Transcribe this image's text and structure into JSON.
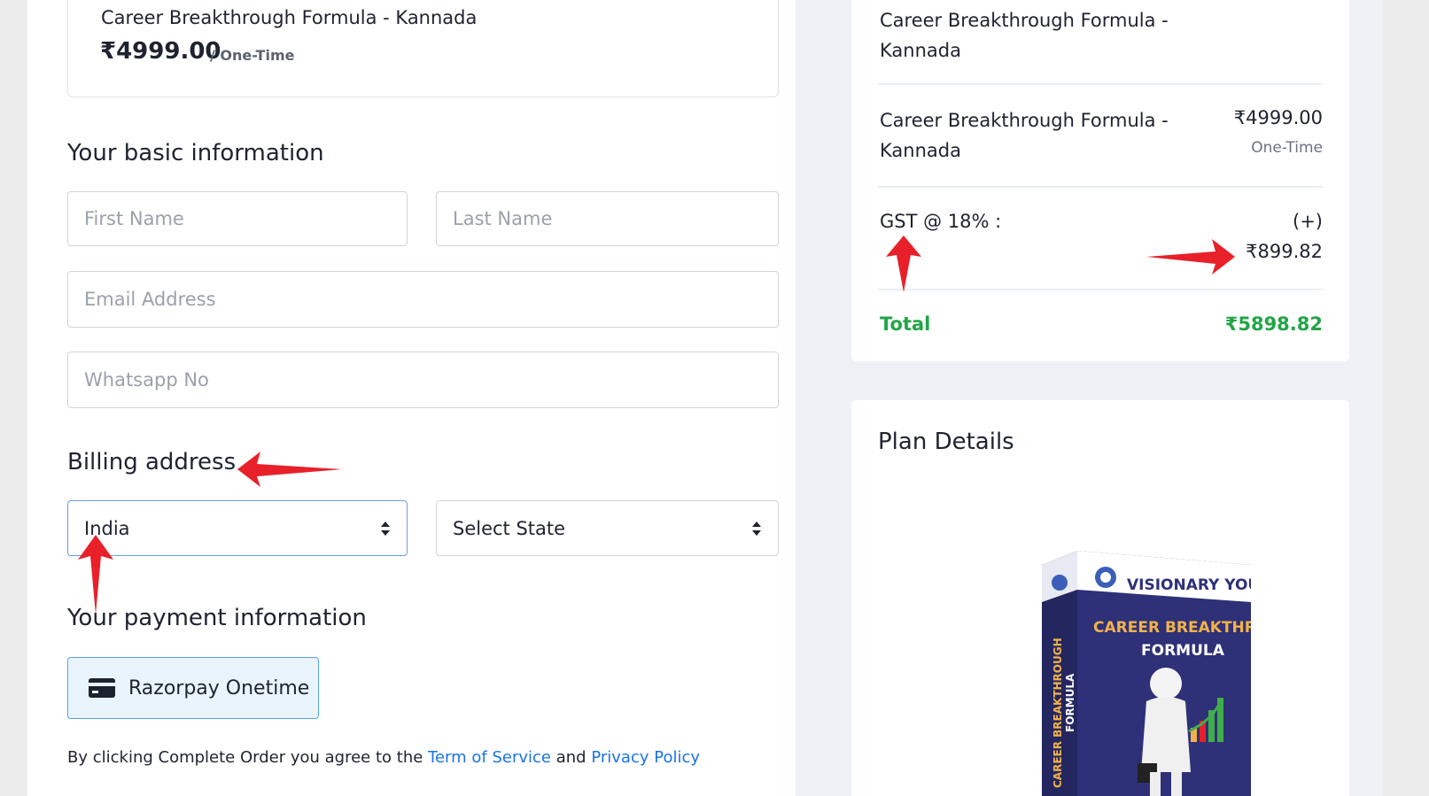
{
  "product": {
    "name": "Career Breakthrough Formula - Kannada",
    "price": "₹4999.00",
    "period": "/ One-Time"
  },
  "basic_info": {
    "title": "Your basic information",
    "first_name_placeholder": "First Name",
    "last_name_placeholder": "Last Name",
    "email_placeholder": "Email Address",
    "whatsapp_placeholder": "Whatsapp No"
  },
  "billing": {
    "title": "Billing address",
    "country_value": "India",
    "state_value": "Select State"
  },
  "payment": {
    "title": "Your payment information",
    "method_label": "Razorpay Onetime",
    "agree_prefix": "By clicking Complete Order you agree to the",
    "terms_link": "Term of Service",
    "agree_and": "and",
    "privacy_link": "Privacy Policy"
  },
  "summary": {
    "title": "Career Breakthrough Formula - Kannada",
    "item_name": "Career Breakthrough Formula - Kannada",
    "item_price": "₹4999.00",
    "item_period": "One-Time",
    "gst_label": "GST @ 18% :",
    "gst_sign": "(+)",
    "gst_value": "₹899.82",
    "total_label": "Total",
    "total_value": "₹5898.82"
  },
  "plan": {
    "title": "Plan Details",
    "box_brand": "VISIONARY YOU",
    "box_title_line1": "CAREER BREAKTHROUGH",
    "box_title_line2": "FORMULA",
    "box_side_line1": "CAREER BREAKTHROUGH",
    "box_side_line2": "FORMULA"
  },
  "colors": {
    "accent_green": "#22a547",
    "link_blue": "#1a73e8",
    "annotation_red": "#e8202a",
    "box_navy": "#2c2f73"
  },
  "icons": [
    "credit-card-icon",
    "select-caret-icon",
    "red-arrow-annotation"
  ]
}
